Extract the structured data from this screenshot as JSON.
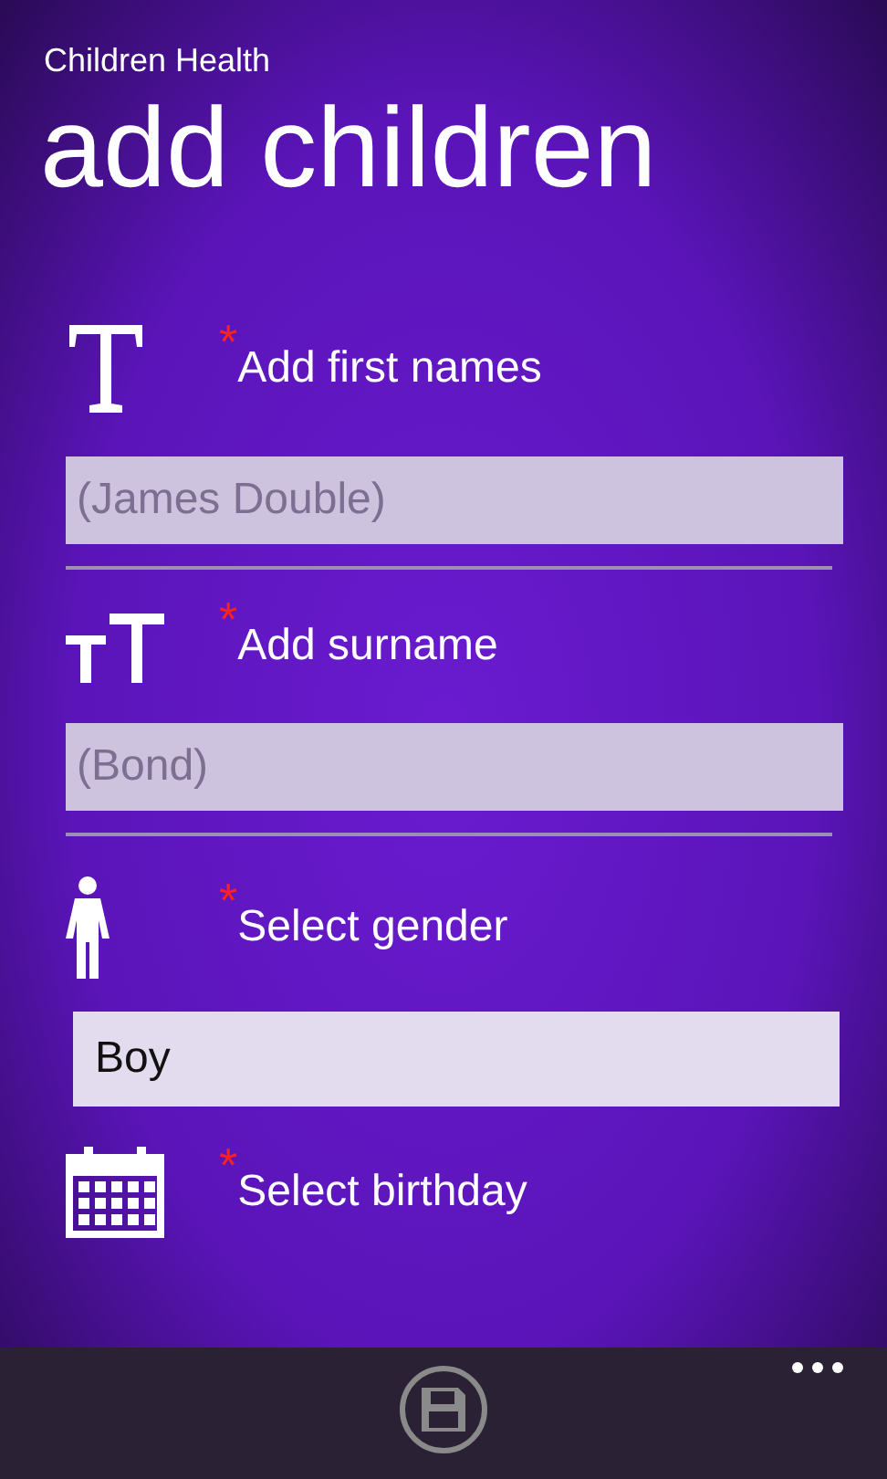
{
  "app_title": "Children Health",
  "page_title": "add children",
  "sections": [
    {
      "marker": "*",
      "label": "Add first names",
      "field": {
        "kind": "input",
        "placeholder": "(James Double)"
      }
    },
    {
      "marker": "*",
      "label": "Add surname",
      "field": {
        "kind": "input",
        "placeholder": "(Bond)"
      }
    },
    {
      "marker": "*",
      "label": "Select gender",
      "field": {
        "kind": "select",
        "value": "Boy"
      }
    },
    {
      "marker": "*",
      "label": "Select birthday"
    }
  ]
}
